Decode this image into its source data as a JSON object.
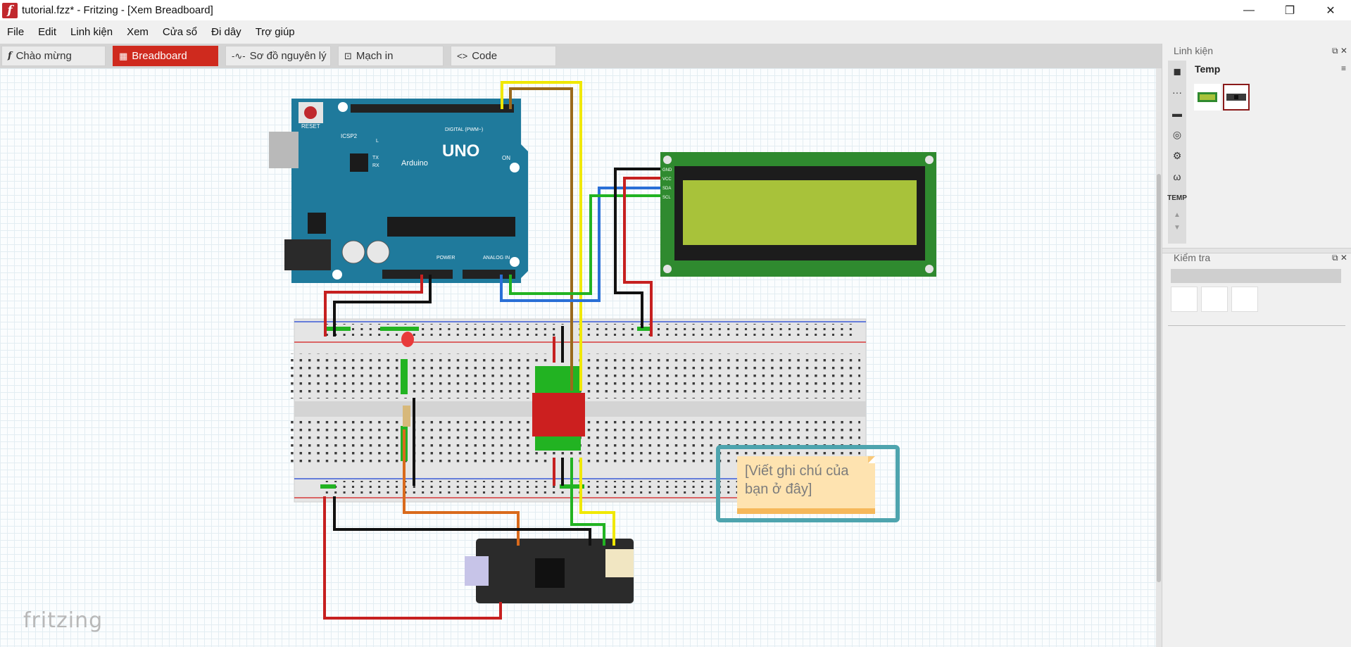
{
  "window": {
    "title": "tutorial.fzz* - Fritzing - [Xem Breadboard]",
    "app_icon_glyph": "f",
    "minimize_glyph": "—",
    "maximize_glyph": "❐",
    "close_glyph": "✕"
  },
  "menu": [
    "File",
    "Edit",
    "Linh kiện",
    "Xem",
    "Cửa sổ",
    "Đi dây",
    "Trợ giúp"
  ],
  "tabs": [
    {
      "label": "Chào mừng",
      "icon": "f",
      "icon_name": "fritzing-icon",
      "active": false
    },
    {
      "label": "Breadboard",
      "icon": "▦",
      "icon_name": "breadboard-icon",
      "active": true
    },
    {
      "label": "Sơ đồ nguyên lý",
      "icon": "-∿-",
      "icon_name": "schematic-icon",
      "active": false
    },
    {
      "label": "Mạch in",
      "icon": "⊡",
      "icon_name": "pcb-icon",
      "active": false
    },
    {
      "label": "Code",
      "icon": "<>",
      "icon_name": "code-icon",
      "active": false
    }
  ],
  "parts_panel": {
    "title": "Linh kiện",
    "bin_name": "Temp",
    "bin_icons": [
      "core-parts-icon",
      "more-icon",
      "chip-icon",
      "antenna-icon",
      "robot-icon",
      "omega-icon"
    ],
    "bin_icon_glyphs": [
      "◼",
      "···",
      "▬",
      "◎",
      "⚙",
      "ω"
    ],
    "bin_label": "TEMP",
    "scroll_up": "▲",
    "scroll_down": "▼",
    "menu_glyph": "≡",
    "panel_controls": "⧉ ✕"
  },
  "inspector_panel": {
    "title": "Kiểm tra",
    "panel_controls": "⧉ ✕"
  },
  "note": {
    "text": "[Viết ghi chú của bạn ở đây]"
  },
  "arduino": {
    "reset": "RESET",
    "icsp2": "ICSP2",
    "brand": "Arduino",
    "model": "UNO",
    "digital": "DIGITAL (PWM~)",
    "on": "ON",
    "power": "POWER",
    "analog": "ANALOG IN",
    "tx": "TX",
    "rx": "RX",
    "l": "L",
    "icsp": "ICSP"
  },
  "lcd": {
    "pins": [
      "GND",
      "VCC",
      "SDA",
      "SCL"
    ]
  },
  "footer": {
    "logo": "fritzing"
  },
  "colors": {
    "accent_red": "#cf2a1e",
    "arduino_blue": "#1f7a9c",
    "lcd_green": "#2f8a2f",
    "lcd_screen": "#a8c23a",
    "note_border": "#4ea4ae",
    "note_fill": "#fee3b0"
  }
}
